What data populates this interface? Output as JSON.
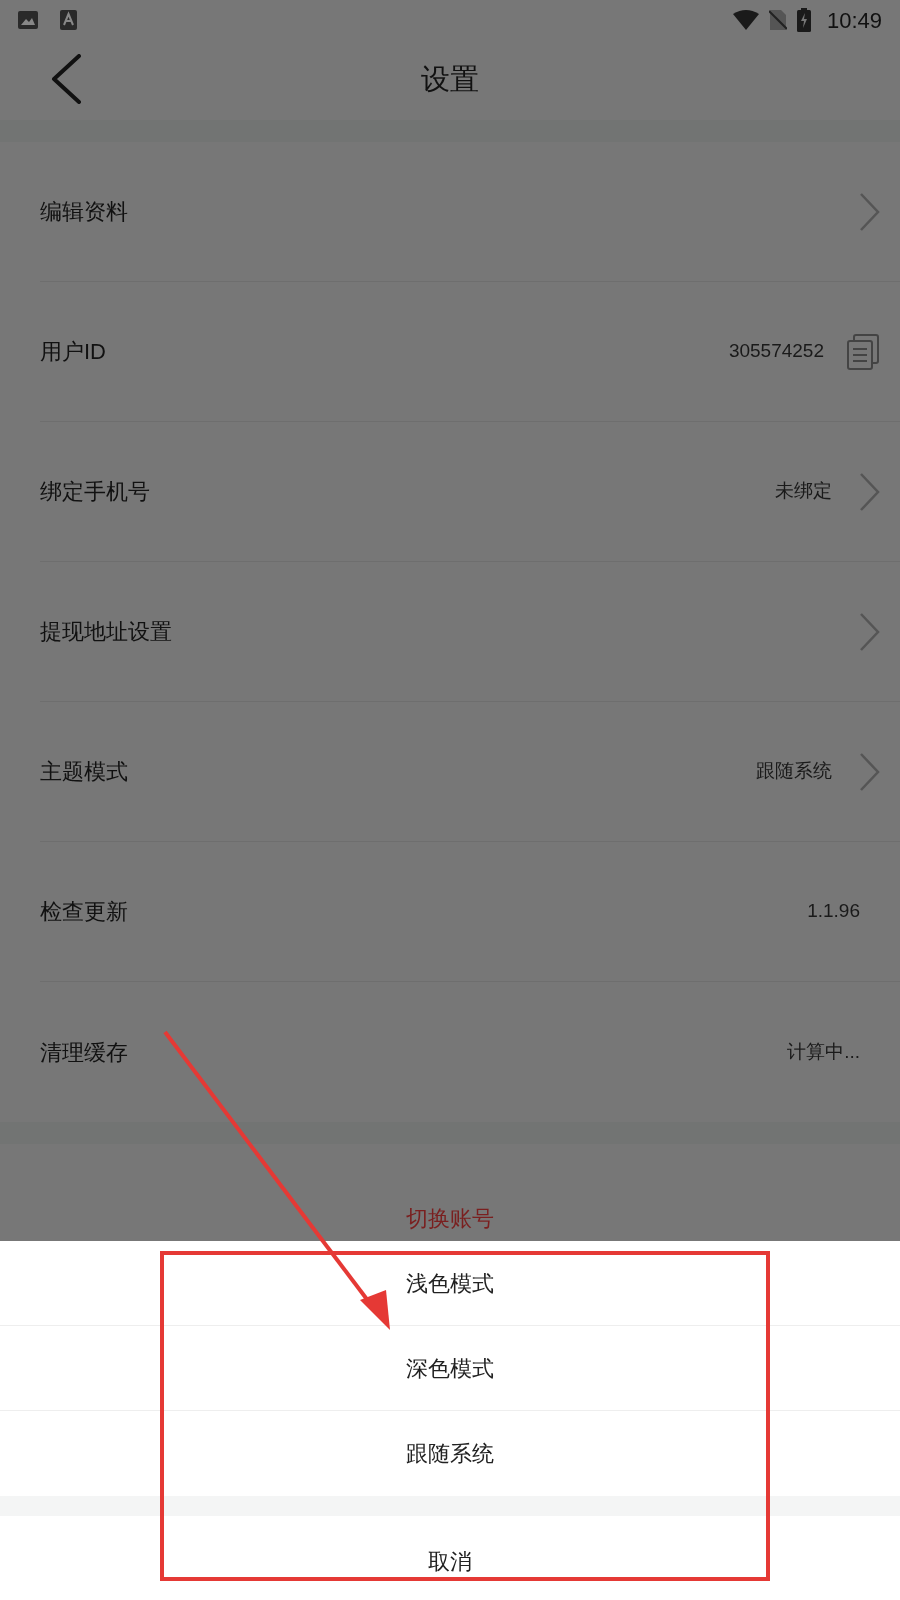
{
  "status_bar": {
    "time": "10:49"
  },
  "header": {
    "title": "设置"
  },
  "rows": [
    {
      "label": "编辑资料",
      "kind": "chevron"
    },
    {
      "label": "用户ID",
      "value": "305574252",
      "kind": "copy"
    },
    {
      "label": "绑定手机号",
      "value": "未绑定",
      "kind": "chevron"
    },
    {
      "label": "提现地址设置",
      "kind": "chevron"
    },
    {
      "label": "主题模式",
      "value": "跟随系统",
      "kind": "chevron"
    },
    {
      "label": "检查更新",
      "value": "1.1.96",
      "kind": "plain"
    },
    {
      "label": "清理缓存",
      "value": "计算中...",
      "kind": "plain"
    }
  ],
  "switch_account": "切换账号",
  "sheet": {
    "options": [
      "浅色模式",
      "深色模式",
      "跟随系统"
    ],
    "cancel": "取消"
  }
}
